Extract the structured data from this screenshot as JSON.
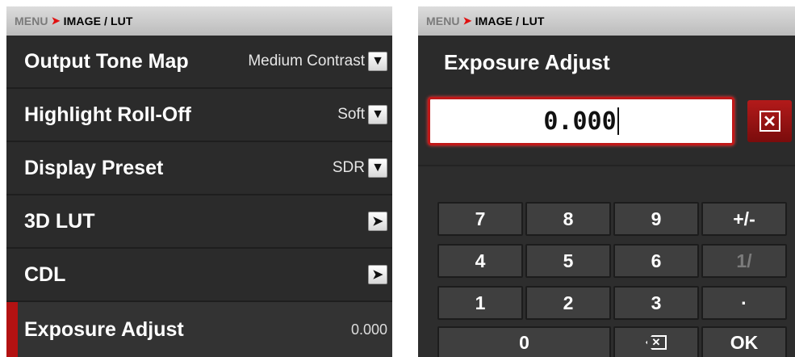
{
  "left": {
    "breadcrumb": {
      "menu": "MENU",
      "separator": "➤",
      "page": "IMAGE / LUT"
    },
    "rows": [
      {
        "label": "Output Tone Map",
        "value": "Medium Contrast",
        "control": "dropdown-icon"
      },
      {
        "label": "Highlight Roll-Off",
        "value": "Soft",
        "control": "dropdown-icon"
      },
      {
        "label": "Display Preset",
        "value": "SDR",
        "control": "dropdown-icon"
      },
      {
        "label": "3D LUT",
        "value": "",
        "control": "arrow-right-icon"
      },
      {
        "label": "CDL",
        "value": "",
        "control": "arrow-right-icon"
      },
      {
        "label": "Exposure Adjust",
        "value": "0.000",
        "control": "none",
        "selected": true
      }
    ]
  },
  "right": {
    "breadcrumb": {
      "menu": "MENU",
      "separator": "➤",
      "page": "IMAGE / LUT"
    },
    "title": "Exposure Adjust",
    "entry_value": "0.000",
    "keys": [
      "7",
      "8",
      "9",
      "+/-",
      "4",
      "5",
      "6",
      "1/",
      "1",
      "2",
      "3",
      "·",
      "0",
      "⌫",
      "OK"
    ],
    "disabled_keys": [
      "1/"
    ]
  },
  "colors": {
    "accent": "#b31212",
    "background": "#2b2b2b",
    "breadcrumb_bg": "#c8c8c8"
  }
}
